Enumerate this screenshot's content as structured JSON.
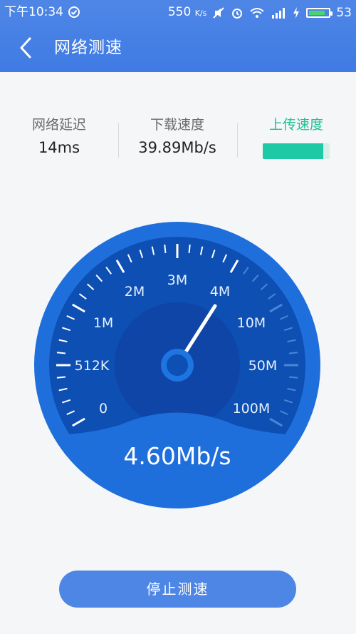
{
  "status_bar": {
    "time": "下午10:34",
    "net_speed": "550",
    "net_unit": "K/s",
    "battery_text": "53",
    "icons": [
      "circle-check-icon",
      "mute-icon",
      "alarm-icon",
      "wifi-icon",
      "signal-icon",
      "charging-icon",
      "battery-icon"
    ]
  },
  "app_bar": {
    "title": "网络测速",
    "back_icon": "chevron-left-icon"
  },
  "stats": {
    "latency": {
      "label": "网络延迟",
      "value": "14ms"
    },
    "download": {
      "label": "下载速度",
      "value": "39.89Mb/s"
    },
    "upload": {
      "label": "上传速度",
      "progress": 0.9,
      "color": "#1ec9a5"
    }
  },
  "gauge": {
    "reading": "4.60Mb/s",
    "scale_labels": [
      "0",
      "512K",
      "1M",
      "2M",
      "3M",
      "4M",
      "10M",
      "50M",
      "100M"
    ],
    "needle_value_label": "4M",
    "colors": {
      "outer": "#1e6fdc",
      "face": "#0d4fb3",
      "inner": "#0f45a6",
      "needle": "#ffffff",
      "active_tick": "#ffffff",
      "inactive_tick": "#4a86d6"
    }
  },
  "actions": {
    "stop_label": "停止测速"
  }
}
